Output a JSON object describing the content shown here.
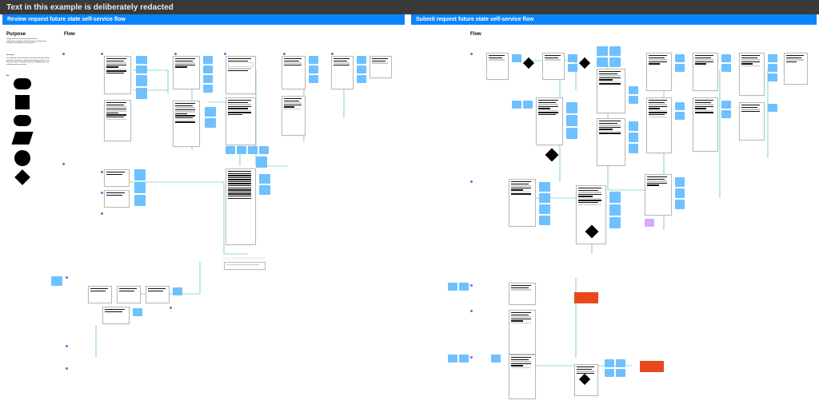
{
  "topbar": {
    "notice": "Text in this example is deliberately redacted"
  },
  "panels": {
    "left": {
      "title": "Review request future state self-service flow"
    },
    "right": {
      "title": "Submit request future state self-service flow"
    }
  },
  "left_sections": {
    "purpose": {
      "heading": "Purpose",
      "body": "Design a full future state user flow based on requirements and goals, which has been annotated with a range of considerations and questions."
    },
    "outcomes": {
      "heading": "Outcomes",
      "body": "Our aspiration is that everyone reviews this flow ahead of the workshop, writing down questions or thoughts which we can then go through as a group and discuss, plugging gaps, and re-aligning where necessary."
    },
    "flow": {
      "heading": "Flow"
    },
    "legend_title": "Key"
  },
  "right_sections": {
    "flow": {
      "heading": "Flow"
    }
  },
  "legend_items": [
    "rounded",
    "square",
    "rounded",
    "skew",
    "circle",
    "diamond"
  ],
  "colors": {
    "accent": "#0a84ff",
    "note": "#6ec0ff",
    "connector": "#28c28b",
    "marker": "#a14ce8",
    "highlight": "#e8481c"
  }
}
